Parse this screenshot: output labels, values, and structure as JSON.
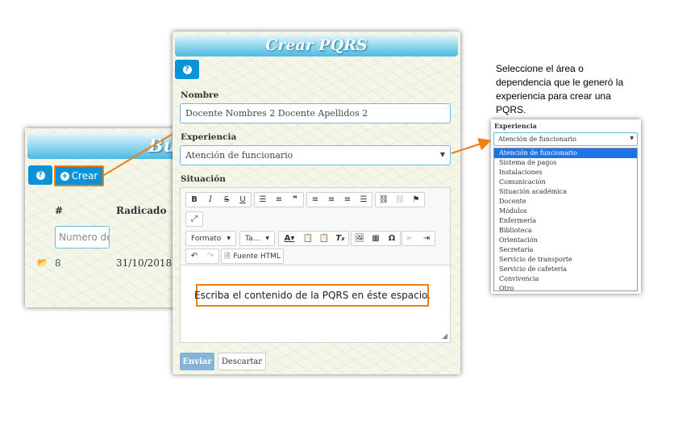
{
  "back_panel": {
    "header_title": "Bu",
    "help_icon": "question-circle-icon",
    "crear_label": "Crear",
    "columns": [
      "#",
      "Radicado"
    ],
    "filter_placeholder": "Numero de",
    "rows": [
      {
        "number": "8",
        "radicado": "31/10/2018"
      }
    ]
  },
  "form": {
    "title": "Crear PQRS",
    "nombre_label": "Nombre",
    "nombre_value": "Docente Nombres 2 Docente Apellidos 2",
    "experiencia_label": "Experiencia",
    "experiencia_value": "Atención de funcionario",
    "situacion_label": "Situación",
    "toolbar": {
      "formato_label": "Formato",
      "tamano_label": "Ta...",
      "source_label": "Fuente HTML"
    },
    "content_hint": "Escriba el contenido de la PQRS en éste espacio.",
    "enviar_label": "Enviar",
    "descartar_label": "Descartar"
  },
  "annotation": {
    "text": "Seleccione el área o dependencia que le generó la experiencia para crear una PQRS."
  },
  "dropdown": {
    "label": "Experiencia",
    "selected": "Atención de funcionario",
    "options": [
      "Atención de funcionario",
      "Sistema de pagos",
      "Instalaciones",
      "Comunicación",
      "Situación académica",
      "Docente",
      "Módulos",
      "Enfermería",
      "Biblioteca",
      "Orientación",
      "Secretaría",
      "Servicio de transporte",
      "Servicio de cafetería",
      "Convivencia",
      "Otro"
    ]
  },
  "colors": {
    "accent_blue": "#0b93d5",
    "highlight_orange": "#f07f12",
    "selected_option": "#1e73e8"
  }
}
